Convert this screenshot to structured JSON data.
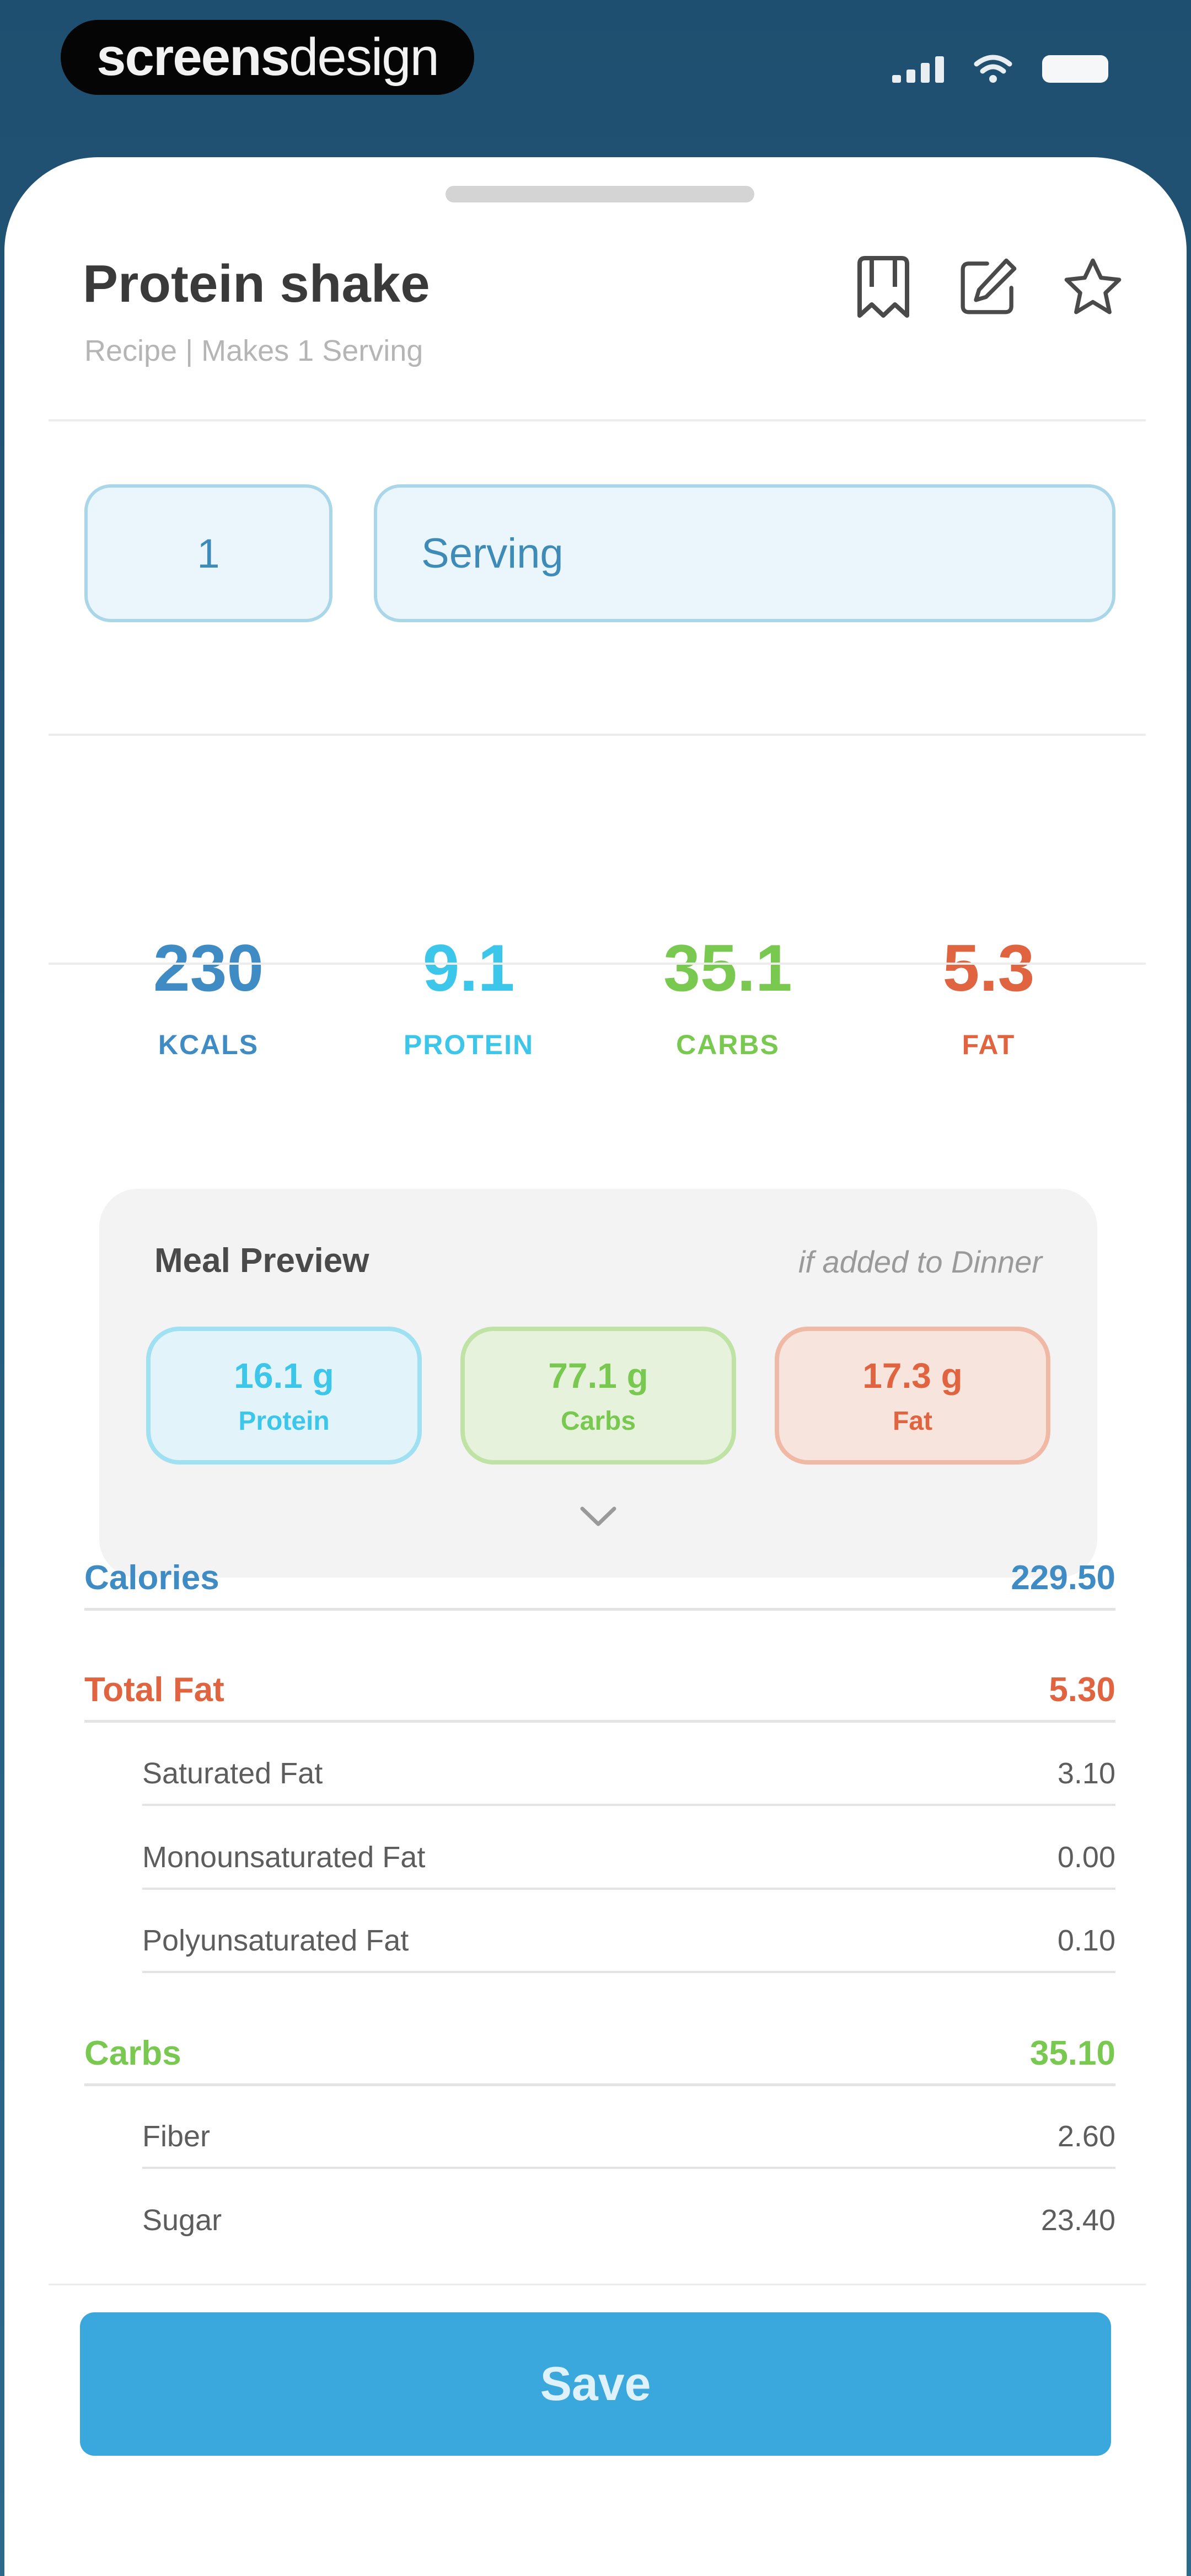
{
  "status_bar": {
    "brand_left": "screens",
    "brand_right": "design"
  },
  "header": {
    "title": "Protein shake",
    "subtitle": "Recipe | Makes 1 Serving",
    "actions": [
      "bookmark-icon",
      "edit-icon",
      "star-icon"
    ]
  },
  "serving": {
    "quantity": "1",
    "unit": "Serving"
  },
  "macros": [
    {
      "value": "230",
      "label": "KCALS",
      "color": "#3f8bc4"
    },
    {
      "value": "9.1",
      "label": "PROTEIN",
      "color": "#3cc6ea"
    },
    {
      "value": "35.1",
      "label": "CARBS",
      "color": "#79c84f"
    },
    {
      "value": "5.3",
      "label": "FAT",
      "color": "#e0643f"
    }
  ],
  "meal_preview": {
    "title": "Meal Preview",
    "note": "if added to Dinner",
    "chips": [
      {
        "value": "16.1 g",
        "label": "Protein",
        "color": "#3cc6ea",
        "bg": "#e2f3fa",
        "border": "#9fe0f2"
      },
      {
        "value": "77.1 g",
        "label": "Carbs",
        "color": "#79c84f",
        "bg": "#e6f2dc",
        "border": "#bfe3a5"
      },
      {
        "value": "17.3 g",
        "label": "Fat",
        "color": "#e0643f",
        "bg": "#f7e4dc",
        "border": "#f0b9a5"
      }
    ]
  },
  "nutrition": {
    "calories": {
      "label": "Calories",
      "value": "229.50",
      "color": "#3f8bc4"
    },
    "total_fat": {
      "label": "Total Fat",
      "value": "5.30",
      "color": "#e0643f"
    },
    "saturated_fat": {
      "label": "Saturated Fat",
      "value": "3.10"
    },
    "monounsaturated_fat": {
      "label": "Monounsaturated Fat",
      "value": "0.00"
    },
    "polyunsaturated_fat": {
      "label": "Polyunsaturated Fat",
      "value": "0.10"
    },
    "carbs": {
      "label": "Carbs",
      "value": "35.10",
      "color": "#79c84f"
    },
    "fiber": {
      "label": "Fiber",
      "value": "2.60"
    },
    "sugar": {
      "label": "Sugar",
      "value": "23.40"
    }
  },
  "save_label": "Save"
}
